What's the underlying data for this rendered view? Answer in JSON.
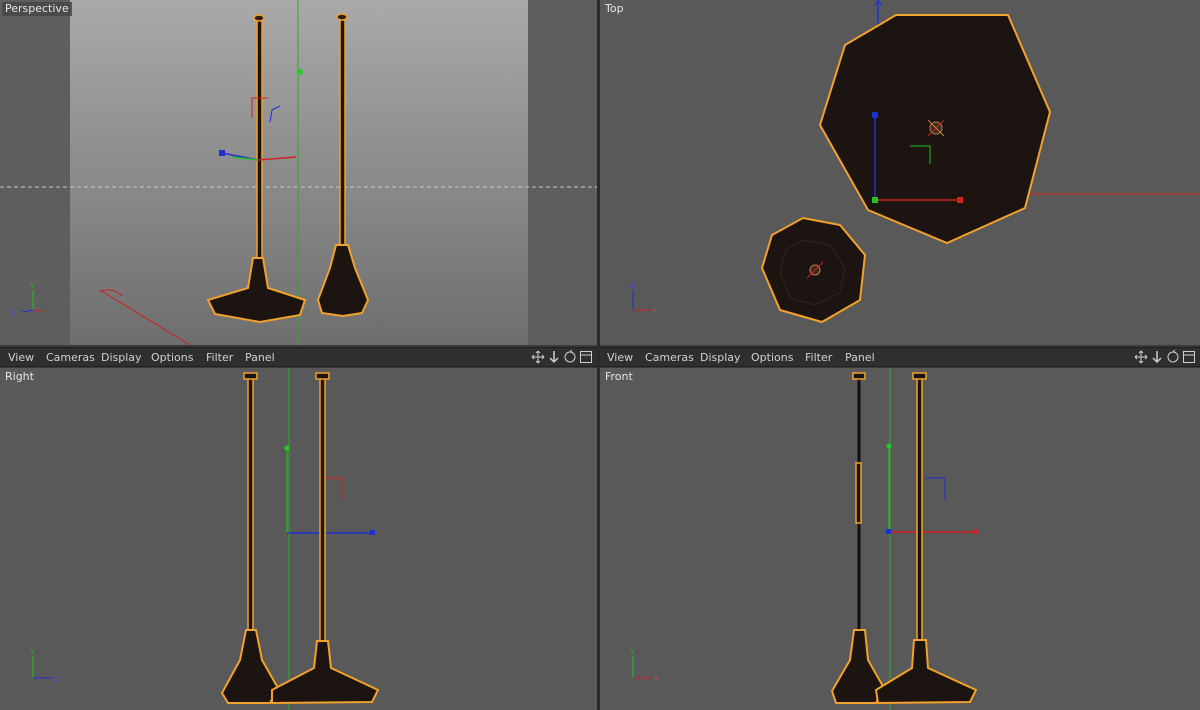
{
  "viewports": {
    "perspective": {
      "label": "Perspective"
    },
    "top": {
      "label": "Top"
    },
    "right": {
      "label": "Right"
    },
    "front": {
      "label": "Front"
    }
  },
  "menu": {
    "left": {
      "view": "View",
      "cameras": "Cameras",
      "display": "Display",
      "options": "Options",
      "filter": "Filter",
      "panel": "Panel"
    },
    "right": {
      "view": "View",
      "cameras": "Cameras",
      "display": "Display",
      "options": "Options",
      "filter": "Filter",
      "panel": "Panel"
    }
  },
  "nav_icons": [
    "move-view-icon",
    "zoom-view-icon",
    "rotate-view-icon",
    "toggle-view-icon"
  ],
  "axis_labels": {
    "x": "X",
    "y": "Y",
    "z": "Z"
  },
  "colors": {
    "selection_outline": "#f2a12a",
    "axis_x": "#e02020",
    "axis_y": "#20c020",
    "axis_z": "#2020e0",
    "object_fill": "#1c1410",
    "viewport_bg": "#595959"
  }
}
